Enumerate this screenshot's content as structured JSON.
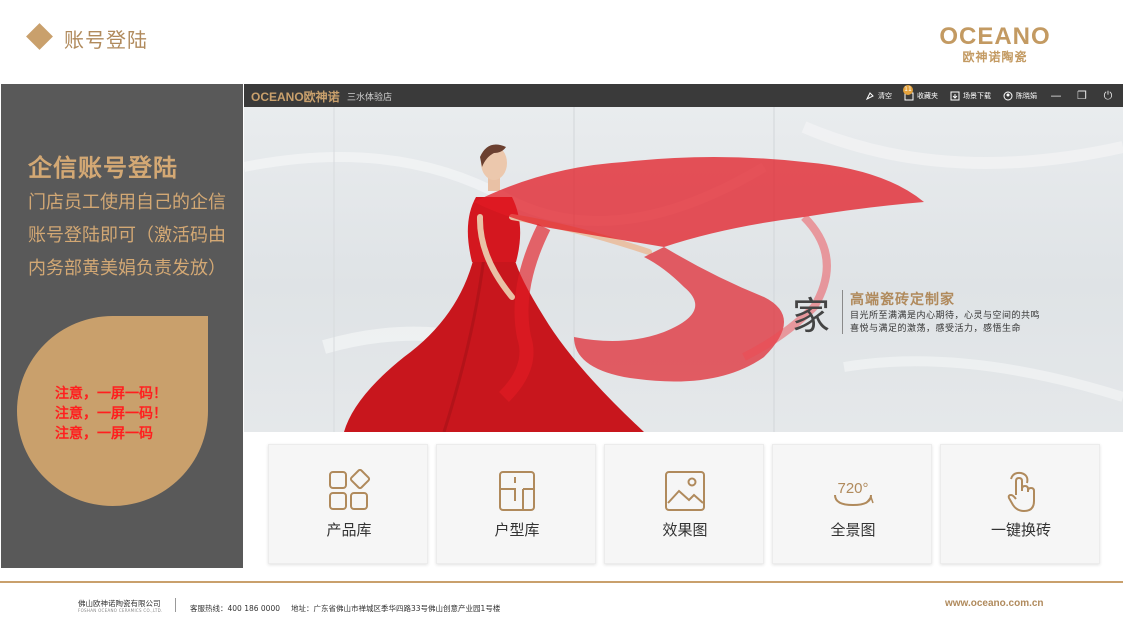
{
  "header": {
    "title": "账号登陆",
    "logo_main": "OCEANO",
    "logo_sub": "欧神诺陶瓷"
  },
  "left_panel": {
    "title": "企信账号登陆",
    "description": "门店员工使用自己的企信账号登陆即可（激活码由内务部黄美娟负责发放）",
    "notes": [
      "注意，一屏一码！",
      "注意，一屏一码！",
      "注意，一屏一码"
    ]
  },
  "app": {
    "titlebar": {
      "logo": "OCEANO欧神诺",
      "store": "三水体验店",
      "actions": [
        {
          "label": "清空",
          "icon": "broom-icon"
        },
        {
          "label": "收藏夹",
          "icon": "folder-icon",
          "badge": "11"
        },
        {
          "label": "场景下载",
          "icon": "download-icon"
        },
        {
          "label": "陈晓娟",
          "icon": "user-icon"
        }
      ],
      "window_controls": [
        "—",
        "❐",
        "⏻"
      ]
    },
    "banner": {
      "char": "家",
      "title": "高端瓷砖定制家",
      "line1": "目光所至满满是内心期待，心灵与空间的共鸣",
      "line2": "喜悦与满足的激荡，感受活力，感悟生命"
    },
    "tiles": [
      {
        "label": "产品库",
        "icon": "product-library-icon"
      },
      {
        "label": "户型库",
        "icon": "floorplan-icon"
      },
      {
        "label": "效果图",
        "icon": "image-icon"
      },
      {
        "label": "全景图",
        "icon": "panorama-720-icon",
        "icon_text": "720°"
      },
      {
        "label": "一键换砖",
        "icon": "tap-hand-icon"
      }
    ]
  },
  "footer": {
    "company": "佛山欧神诺陶瓷有限公司",
    "company_en": "FOSHAN OCEANO CERAMICS CO.,LTD.",
    "hotline": "客服热线：400 186 0000",
    "address": "地址：广东省佛山市禅城区季华四路33号佛山创意产业园1号楼",
    "website": "www.oceano.com.cn"
  },
  "colors": {
    "accent_gold": "#c9a06c",
    "panel_gray": "#595959",
    "note_red": "#ff1f1f",
    "titlebar": "#3a3a3a"
  }
}
